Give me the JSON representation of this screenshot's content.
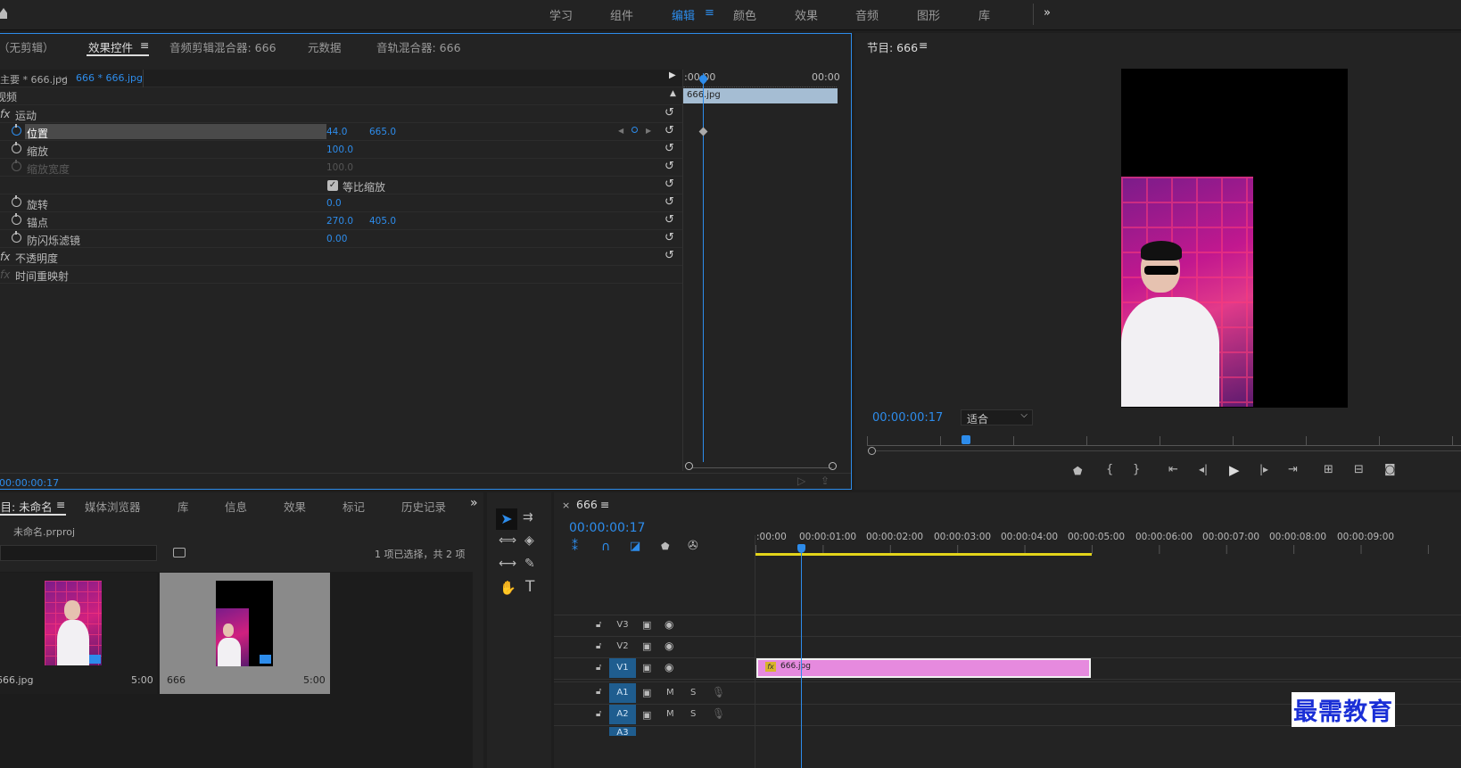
{
  "workspaces": [
    "学习",
    "组件",
    "编辑",
    "颜色",
    "效果",
    "音频",
    "图形",
    "库"
  ],
  "workspace_active": "编辑",
  "effect_tabs": [
    "（无剪辑）",
    "效果控件",
    "音频剪辑混合器: 666",
    "元数据",
    "音轨混合器: 666"
  ],
  "clip_selector": {
    "master": "主要 * 666.jpg",
    "current": "666 * 666.jpg"
  },
  "section_video": "视频",
  "effects": {
    "motion": "运动",
    "position": {
      "label": "位置",
      "x": "44.0",
      "y": "665.0"
    },
    "scale": {
      "label": "缩放",
      "value": "100.0"
    },
    "scale_width": {
      "label": "缩放宽度",
      "value": "100.0"
    },
    "uniform_scale": "等比缩放",
    "rotation": {
      "label": "旋转",
      "value": "0.0"
    },
    "anchor": {
      "label": "锚点",
      "x": "270.0",
      "y": "405.0"
    },
    "anti_flicker": {
      "label": "防闪烁滤镜",
      "value": "0.00"
    },
    "opacity": "不透明度",
    "time_remap": "时间重映射"
  },
  "mini_timeline": {
    "start": ":00:00",
    "end": "00:00",
    "clip": "666.jpg"
  },
  "effect_timecode": "00:00:00:17",
  "program": {
    "title": "节目: 666",
    "timecode": "00:00:00:17",
    "fit": "适合"
  },
  "project_tabs": [
    "项目: 未命名",
    "媒体浏览器",
    "库",
    "信息",
    "效果",
    "标记",
    "历史记录"
  ],
  "project": {
    "file": "未命名.prproj",
    "selection": "1 项已选择，共 2 项",
    "items": [
      {
        "name": "666.jpg",
        "duration": "5:00"
      },
      {
        "name": "666",
        "duration": "5:00"
      }
    ]
  },
  "timeline": {
    "title": "666",
    "timecode": "00:00:00:17",
    "ruler": [
      ":00:00",
      "00:00:01:00",
      "00:00:02:00",
      "00:00:03:00",
      "00:00:04:00",
      "00:00:05:00",
      "00:00:06:00",
      "00:00:07:00",
      "00:00:08:00",
      "00:00:09:00"
    ],
    "video_tracks": [
      "V3",
      "V2",
      "V1"
    ],
    "audio_tracks": [
      "A1",
      "A2",
      "A3"
    ],
    "clip": "666.jpg",
    "m": "M",
    "s": "S"
  },
  "watermark": "最需教育",
  "colors": {
    "accent": "#2d8ceb",
    "clip_pink": "#e68ade",
    "work_area": "#e3d41a",
    "bg": "#232323"
  }
}
